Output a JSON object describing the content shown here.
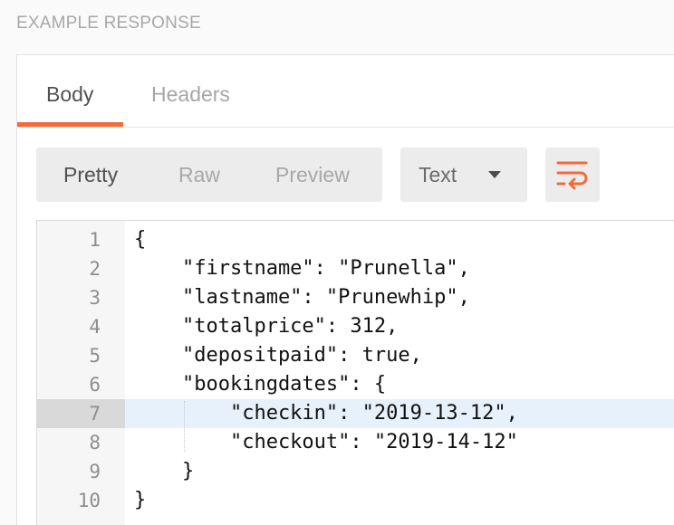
{
  "section": {
    "title": "EXAMPLE RESPONSE"
  },
  "tabs": [
    {
      "label": "Body",
      "active": true
    },
    {
      "label": "Headers",
      "active": false
    }
  ],
  "view_modes": [
    {
      "label": "Pretty",
      "active": true
    },
    {
      "label": "Raw",
      "active": false
    },
    {
      "label": "Preview",
      "active": false
    }
  ],
  "format_select": {
    "value": "Text",
    "icon": "chevron-down-icon"
  },
  "wrap_button": {
    "icon": "wrap-lines-icon"
  },
  "editor": {
    "active_line": 7,
    "lines": [
      {
        "no": "1",
        "text": "{"
      },
      {
        "no": "2",
        "text": "    \"firstname\": \"Prunella\","
      },
      {
        "no": "3",
        "text": "    \"lastname\": \"Prunewhip\","
      },
      {
        "no": "4",
        "text": "    \"totalprice\": 312,"
      },
      {
        "no": "5",
        "text": "    \"depositpaid\": true,"
      },
      {
        "no": "6",
        "text": "    \"bookingdates\": {"
      },
      {
        "no": "7",
        "text": "        \"checkin\": \"2019-13-12\","
      },
      {
        "no": "8",
        "text": "        \"checkout\": \"2019-14-12\""
      },
      {
        "no": "9",
        "text": "    }"
      },
      {
        "no": "10",
        "text": "}"
      }
    ]
  },
  "colors": {
    "accent": "#f26b3a",
    "active_line": "#e7f1fb"
  }
}
